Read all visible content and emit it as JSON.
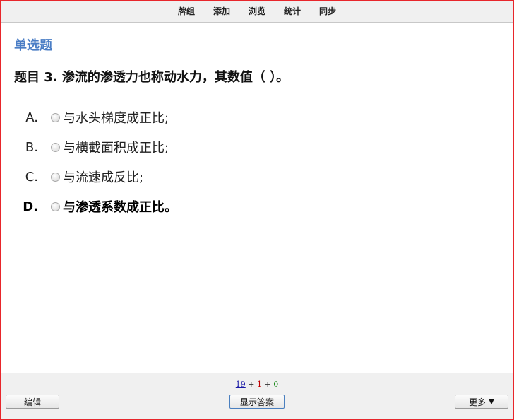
{
  "nav": {
    "items": [
      "牌组",
      "添加",
      "浏览",
      "统计",
      "同步"
    ]
  },
  "question": {
    "type_label": "单选题",
    "title": "题目 3. 渗流的渗透力也称动水力，其数值（ ）。",
    "options": [
      {
        "letter": "A.",
        "text": "与水头梯度成正比;"
      },
      {
        "letter": "B.",
        "text": "与横截面积成正比;"
      },
      {
        "letter": "C.",
        "text": "与流速成反比;"
      },
      {
        "letter": "D.",
        "text": "与渗透系数成正比。"
      }
    ]
  },
  "counts": {
    "new": "19",
    "learn": "1",
    "review": "0",
    "separator": "+"
  },
  "bottom": {
    "edit_label": "编辑",
    "show_answer_label": "显示答案",
    "more_label": "更多",
    "more_arrow": "▼"
  },
  "colors": {
    "border": "#e8262b",
    "qtype": "#4a7dc5",
    "new": "#1a1aa6",
    "learn": "#c00000",
    "review": "#1a8a1a"
  }
}
